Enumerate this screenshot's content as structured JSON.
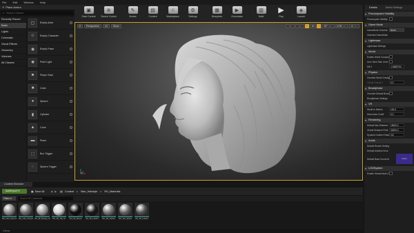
{
  "menu": [
    "File",
    "Edit",
    "Window",
    "Help"
  ],
  "place_actors": {
    "tab_title": "Place Actors",
    "search_placeholder": "Search Classes",
    "categories": [
      "Recently Placed",
      "Basic",
      "Lights",
      "Cinematic",
      "Visual Effects",
      "Geometry",
      "Volumes",
      "All Classes"
    ],
    "active_category": "Basic",
    "items": [
      {
        "label": "Empty Actor",
        "icon": "cube-outline-icon"
      },
      {
        "label": "Empty Character",
        "icon": "character-icon"
      },
      {
        "label": "Empty Pawn",
        "icon": "pawn-icon"
      },
      {
        "label": "Point Light",
        "icon": "bulb-icon"
      },
      {
        "label": "Player Start",
        "icon": "player-start-icon"
      },
      {
        "label": "Cube",
        "icon": "cube-icon"
      },
      {
        "label": "Sphere",
        "icon": "sphere-icon"
      },
      {
        "label": "Cylinder",
        "icon": "cylinder-icon"
      },
      {
        "label": "Cone",
        "icon": "cone-icon"
      },
      {
        "label": "Plane",
        "icon": "plane-icon"
      },
      {
        "label": "Box Trigger",
        "icon": "box-trigger-icon"
      },
      {
        "label": "Sphere Trigger",
        "icon": "sphere-trigger-icon"
      }
    ]
  },
  "toolbar": [
    {
      "label": "Save Current",
      "icon": "save-icon"
    },
    {
      "label": "Source Control",
      "icon": "source-control-icon"
    },
    {
      "label": "Modes",
      "icon": "modes-icon"
    },
    {
      "label": "Content",
      "icon": "content-icon"
    },
    {
      "label": "Marketplace",
      "icon": "marketplace-icon"
    },
    {
      "label": "Settings",
      "icon": "gear-icon"
    },
    {
      "label": "Blueprints",
      "icon": "blueprint-icon"
    },
    {
      "label": "Cinematics",
      "icon": "clapper-icon"
    },
    {
      "label": "Build",
      "icon": "build-icon"
    },
    {
      "label": "Play",
      "icon": "play-icon"
    },
    {
      "label": "Launch",
      "icon": "launch-icon"
    }
  ],
  "viewport": {
    "perspective_label": "Perspective",
    "lit_label": "Lit",
    "show_label": "Show",
    "snap_translate": "10",
    "snap_rotate": "10°",
    "snap_scale": "0.25",
    "camera_speed": "4"
  },
  "content_browser": {
    "tab_title": "Content Browser",
    "add_new_label": "Add/Import ▾",
    "save_all_label": "Save All",
    "path": [
      "Content",
      "Man_Hairstyle",
      "RH_Materials"
    ],
    "filters_label": "Filters ▾",
    "search_placeholder": "Search RH_Materials",
    "assets": [
      {
        "name": "RH_Hair_Haircut",
        "color": "#8a8a8a"
      },
      {
        "name": "RH_Hair_Simple",
        "color": "#6f6f6f"
      },
      {
        "name": "RH_MI_Bangs_St",
        "color": "#9a9a9a"
      },
      {
        "name": "RH_MI_Tail_St",
        "color": "#cfcfcf"
      },
      {
        "name": "RH_MI_Beard",
        "color": "#101010"
      },
      {
        "name": "RH_MI_Hair01",
        "color": "#1a1a1a"
      },
      {
        "name": "RH_MI_Hair02",
        "color": "#777777"
      },
      {
        "name": "RH_MI_Hair03",
        "color": "#666666"
      },
      {
        "name": "RH_MI_Hair04",
        "color": "#555555"
      }
    ],
    "status": "9 items"
  },
  "details": {
    "tab_title": "Details",
    "world_tab": "World Settings",
    "sections": [
      {
        "title": "Precomputed Visibility",
        "rows": [
          {
            "label": "Precompute Visibility",
            "type": "checkbox"
          }
        ]
      },
      {
        "title": "Game Mode",
        "rows": [
          {
            "label": "GameMode Override",
            "type": "dropdown",
            "value": "None"
          },
          {
            "label": "Selected GameMode",
            "type": "label"
          }
        ]
      },
      {
        "title": "Lightmass",
        "rows": [
          {
            "label": "Lightmass Settings",
            "type": "label"
          }
        ]
      },
      {
        "title": "World",
        "rows": [
          {
            "label": "Enable World Composition",
            "type": "checkbox"
          },
          {
            "label": "Use Client Side Level",
            "type": "checkbox"
          },
          {
            "label": "Kill Z",
            "type": "input",
            "value": "-1048575.0"
          }
        ]
      },
      {
        "title": "Physics",
        "rows": [
          {
            "label": "Override World Gravity",
            "type": "checkbox"
          },
          {
            "label": "Global Gravity Z",
            "type": "input",
            "value": "0.0",
            "dim": true
          }
        ]
      },
      {
        "title": "Broadphase",
        "rows": [
          {
            "label": "Override Default Broadphase",
            "type": "checkbox"
          },
          {
            "label": "Broadphase Settings",
            "type": "label"
          }
        ]
      },
      {
        "title": "VR",
        "rows": [
          {
            "label": "World to Meters",
            "type": "input",
            "value": "100.0"
          },
          {
            "label": "Monocular Cutoff",
            "type": "input",
            "value": "0.0"
          }
        ]
      },
      {
        "title": "Rendering",
        "rows": [
          {
            "label": "Default Max Distance",
            "type": "input",
            "value": "15000.0"
          },
          {
            "label": "Global Distance Field",
            "type": "input",
            "value": "20000.0"
          },
          {
            "label": "Dynamic Indirect Shadow",
            "type": "input",
            "value": "0.8"
          }
        ]
      },
      {
        "title": "Audio",
        "rows": [
          {
            "label": "Default Reverb Settings",
            "type": "label"
          },
          {
            "label": "Default Ambient Zone",
            "type": "label"
          },
          {
            "label": "Default Base Sound Mix",
            "type": "swatch",
            "value": "None"
          }
        ]
      },
      {
        "title": "LODSystem",
        "rows": [
          {
            "label": "Enable Hierarchical LOD",
            "type": "checkbox"
          }
        ]
      }
    ]
  }
}
